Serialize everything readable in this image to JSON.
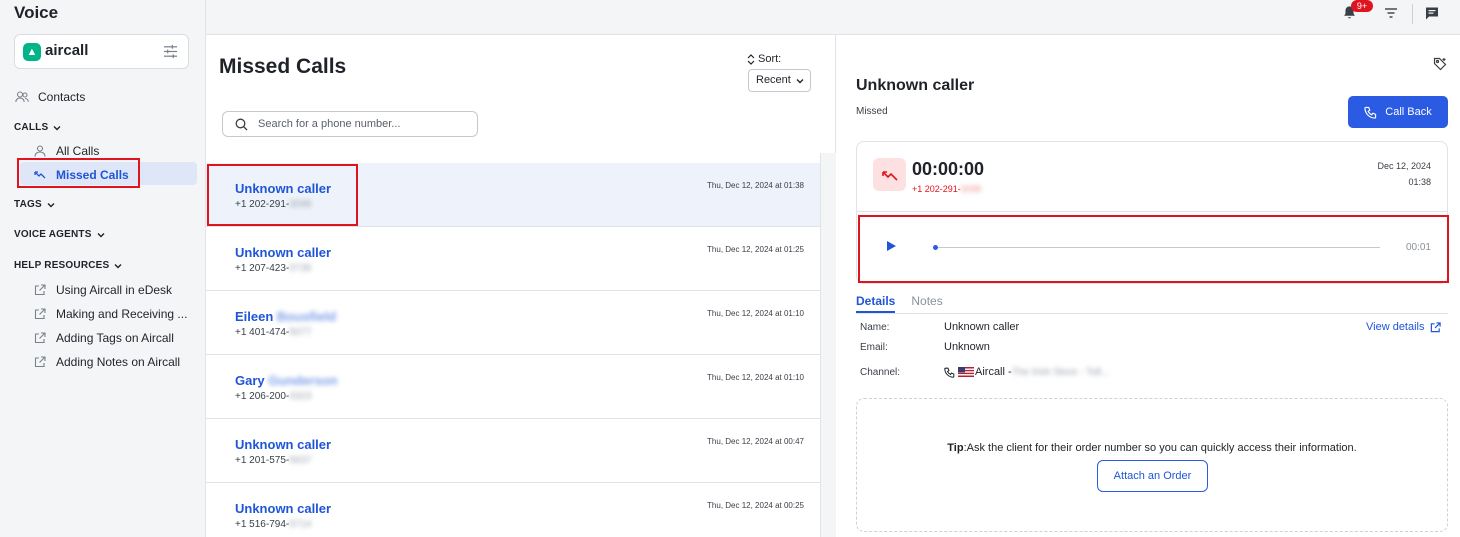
{
  "sidebar": {
    "app_title": "Voice",
    "integration": "aircall",
    "contacts": "Contacts",
    "calls_section": "CALLS",
    "all_calls": "All Calls",
    "missed_calls": "Missed Calls",
    "tags_section": "TAGS",
    "voice_agents_section": "VOICE AGENTS",
    "help_section": "HELP RESOURCES",
    "help_items": [
      "Using Aircall in eDesk",
      "Making and Receiving ...",
      "Adding Tags on Aircall",
      "Adding Notes on Aircall"
    ]
  },
  "topbar": {
    "notification_badge": "9+"
  },
  "list": {
    "title": "Missed Calls",
    "sort_label": "Sort:",
    "sort_value": "Recent",
    "search_placeholder": "Search for a phone number...",
    "calls": [
      {
        "name": "Unknown caller",
        "name_hidden": "",
        "number": "+1 202-291-",
        "number_hidden": "3098",
        "time": "Thu, Dec 12, 2024 at 01:38"
      },
      {
        "name": "Unknown caller",
        "name_hidden": "",
        "number": "+1 207-423-",
        "number_hidden": "0735",
        "time": "Thu, Dec 12, 2024 at 01:25"
      },
      {
        "name": "Eileen",
        "name_hidden": "Bousfield",
        "number": "+1 401-474-",
        "number_hidden": "5077",
        "time": "Thu, Dec 12, 2024 at 01:10"
      },
      {
        "name": "Gary",
        "name_hidden": "Gunderson",
        "number": "+1 206-200-",
        "number_hidden": "4323",
        "time": "Thu, Dec 12, 2024 at 01:10"
      },
      {
        "name": "Unknown caller",
        "name_hidden": "",
        "number": "+1 201-575-",
        "number_hidden": "5637",
        "time": "Thu, Dec 12, 2024 at 00:47"
      },
      {
        "name": "Unknown caller",
        "name_hidden": "",
        "number": "+1 516-794-",
        "number_hidden": "5714",
        "time": "Thu, Dec 12, 2024 at 00:25"
      }
    ]
  },
  "detail": {
    "title": "Unknown caller",
    "status": "Missed",
    "callback_label": "Call Back",
    "duration": "00:00:00",
    "number": "+1 202-291-",
    "number_hidden": "3098",
    "date_line1": "Dec 12, 2024",
    "date_line2": "01:38",
    "playback_progress": 0.0,
    "time_remaining": "00:01",
    "tabs": [
      "Details",
      "Notes"
    ],
    "name_label": "Name:",
    "name_value": "Unknown caller",
    "email_label": "Email:",
    "email_value": "Unknown",
    "channel_label": "Channel:",
    "channel_value": "Aircall - ",
    "channel_hidden": "The Irish Store - Toll...",
    "view_details": "View details",
    "tip_label": "Tip",
    "tip_text": ":Ask the client for their order number so you can quickly access their information.",
    "attach_label": "Attach an Order"
  },
  "colors": {
    "accent": "#2c5be3",
    "missed": "#e0141e",
    "link": "#1f55d6"
  }
}
